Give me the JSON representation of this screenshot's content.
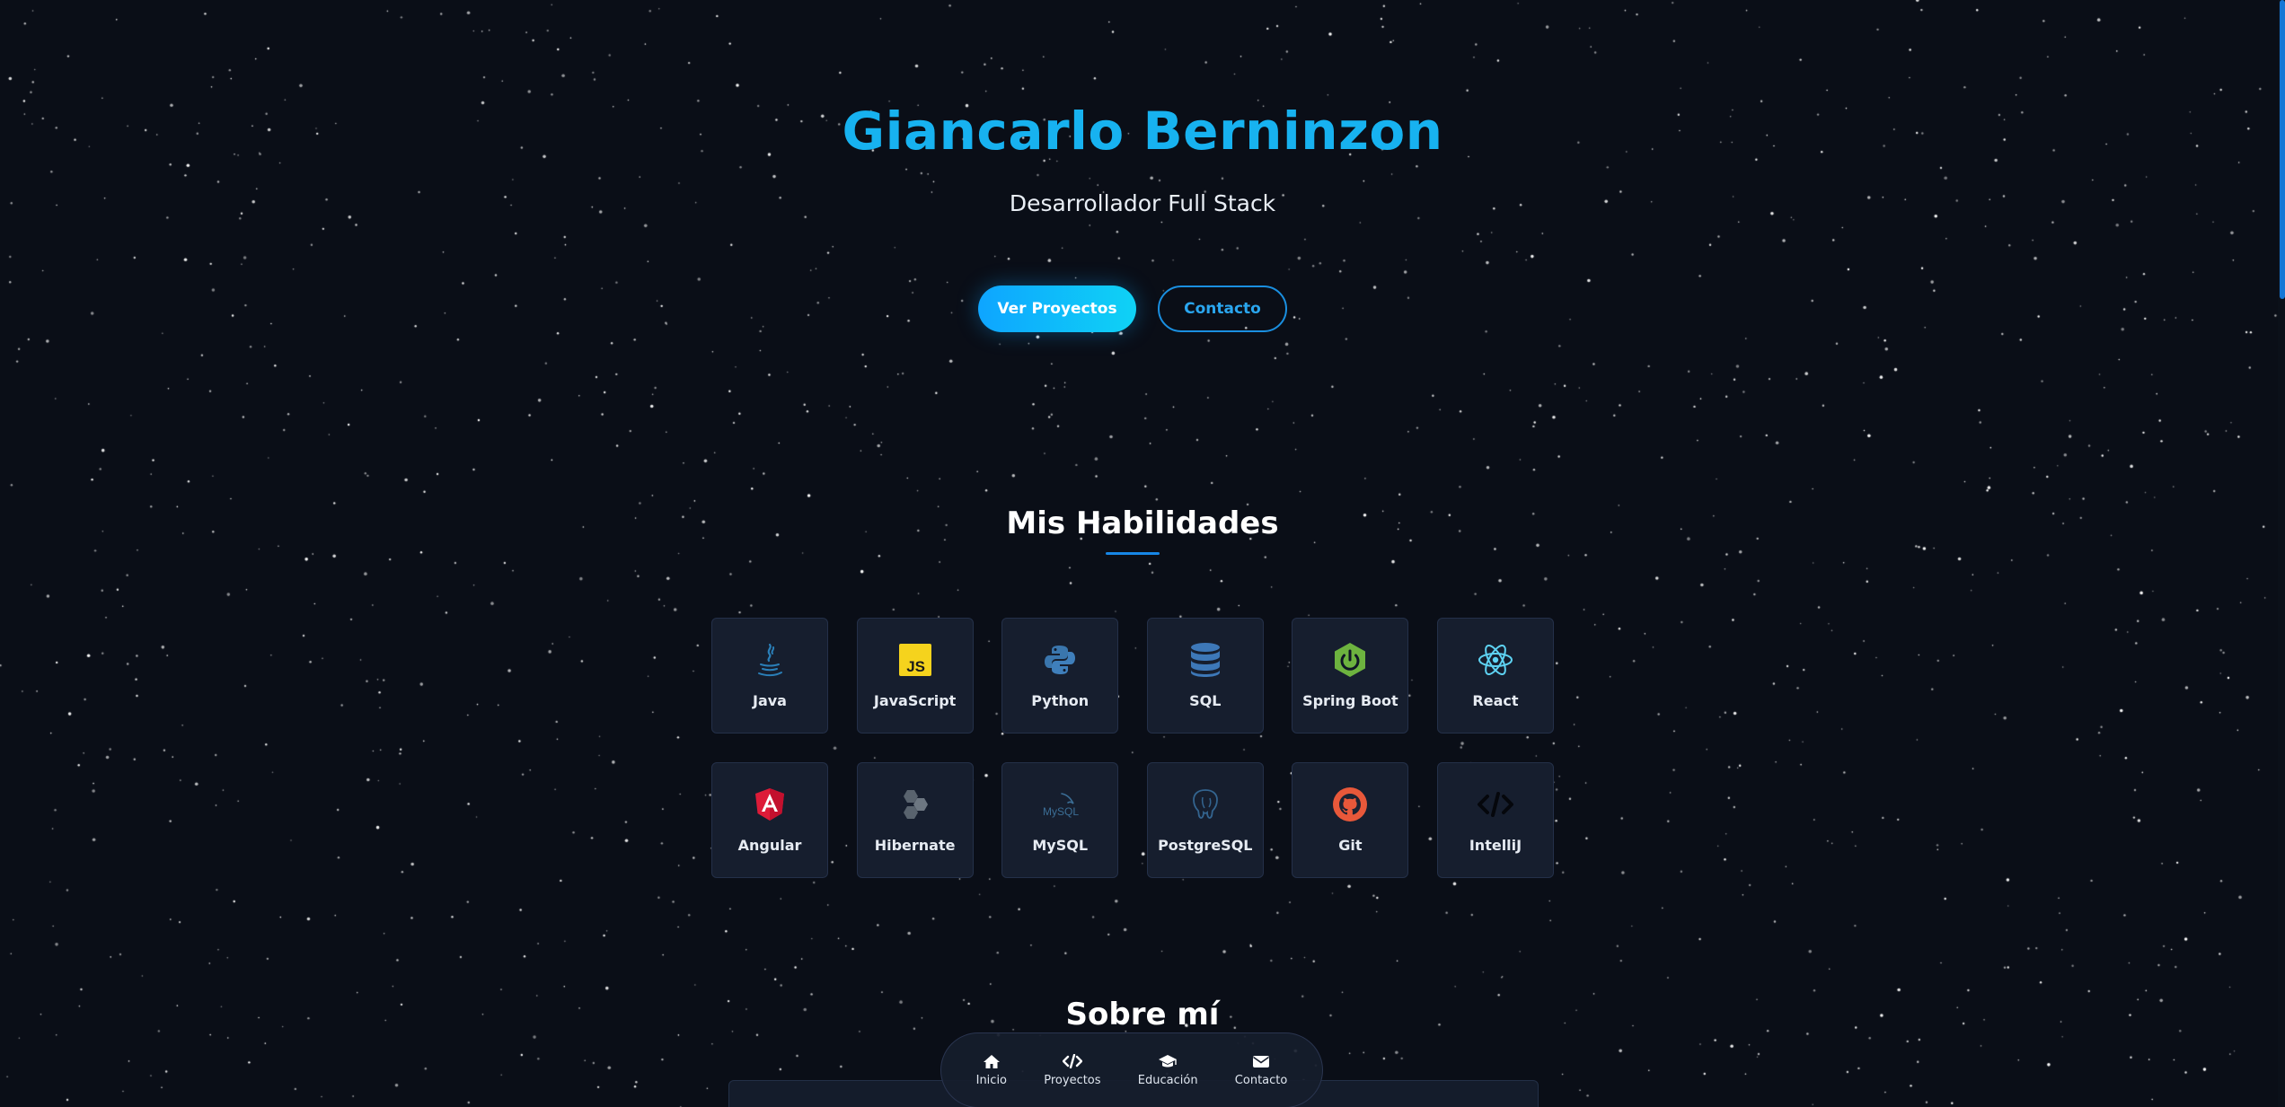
{
  "hero": {
    "name": "Giancarlo Berninzon",
    "role": "Desarrollador Full Stack",
    "primary_button": "Ver Proyectos",
    "secondary_button": "Contacto"
  },
  "skills": {
    "title": "Mis Habilidades",
    "items": [
      {
        "label": "Java",
        "icon": "java-icon"
      },
      {
        "label": "JavaScript",
        "icon": "javascript-icon"
      },
      {
        "label": "Python",
        "icon": "python-icon"
      },
      {
        "label": "SQL",
        "icon": "database-icon"
      },
      {
        "label": "Spring Boot",
        "icon": "spring-boot-icon"
      },
      {
        "label": "React",
        "icon": "react-icon"
      },
      {
        "label": "Angular",
        "icon": "angular-icon"
      },
      {
        "label": "Hibernate",
        "icon": "hibernate-icon"
      },
      {
        "label": "MySQL",
        "icon": "mysql-icon"
      },
      {
        "label": "PostgreSQL",
        "icon": "postgresql-icon"
      },
      {
        "label": "Git",
        "icon": "github-icon"
      },
      {
        "label": "IntelliJ",
        "icon": "code-icon"
      }
    ]
  },
  "about": {
    "title": "Sobre mí"
  },
  "nav": {
    "items": [
      {
        "label": "Inicio",
        "icon": "home-icon"
      },
      {
        "label": "Proyectos",
        "icon": "code-icon"
      },
      {
        "label": "Educación",
        "icon": "graduation-cap-icon"
      },
      {
        "label": "Contacto",
        "icon": "envelope-icon"
      }
    ]
  },
  "colors": {
    "background": "#0a0e17",
    "accent": "#17b2f0",
    "card": "#161e2e"
  }
}
